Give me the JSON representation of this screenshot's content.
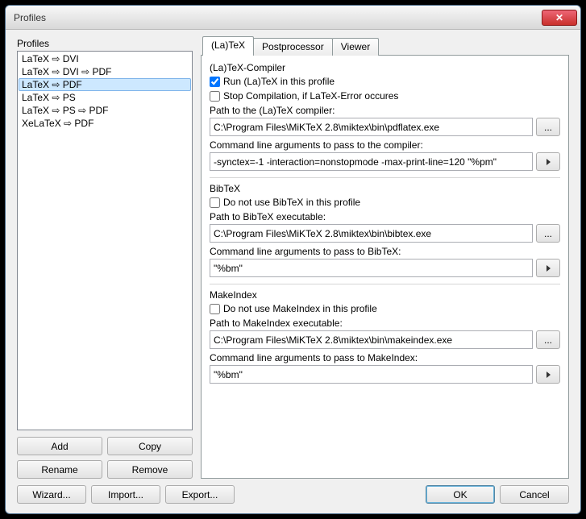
{
  "window": {
    "title": "Profiles"
  },
  "left": {
    "label": "Profiles",
    "items": [
      "LaTeX ⇨ DVI",
      "LaTeX ⇨ DVI ⇨ PDF",
      "LaTeX ⇨ PDF",
      "LaTeX ⇨ PS",
      "LaTeX ⇨ PS ⇨ PDF",
      "XeLaTeX ⇨ PDF"
    ],
    "selected_index": 2,
    "buttons": {
      "add": "Add",
      "copy": "Copy",
      "rename": "Rename",
      "remove": "Remove"
    }
  },
  "tabs": {
    "latex": "(La)TeX",
    "post": "Postprocessor",
    "viewer": "Viewer",
    "active": "latex"
  },
  "latex": {
    "group": "(La)TeX-Compiler",
    "run_label": "Run (La)TeX in this profile",
    "run_checked": true,
    "stop_label": "Stop Compilation, if LaTeX-Error occures",
    "stop_checked": false,
    "path_label": "Path to the (La)TeX compiler:",
    "path_value": "C:\\Program Files\\MiKTeX 2.8\\miktex\\bin\\pdflatex.exe",
    "args_label": "Command line arguments to pass to the compiler:",
    "args_value": "-synctex=-1 -interaction=nonstopmode -max-print-line=120 \"%pm\""
  },
  "bibtex": {
    "group": "BibTeX",
    "skip_label": "Do not use BibTeX in this profile",
    "skip_checked": false,
    "path_label": "Path to BibTeX executable:",
    "path_value": "C:\\Program Files\\MiKTeX 2.8\\miktex\\bin\\bibtex.exe",
    "args_label": "Command line arguments to pass to BibTeX:",
    "args_value": "\"%bm\""
  },
  "makeindex": {
    "group": "MakeIndex",
    "skip_label": "Do not use MakeIndex in this profile",
    "skip_checked": false,
    "path_label": "Path to MakeIndex executable:",
    "path_value": "C:\\Program Files\\MiKTeX 2.8\\miktex\\bin\\makeindex.exe",
    "args_label": "Command line arguments to pass to MakeIndex:",
    "args_value": "\"%bm\""
  },
  "bottom": {
    "wizard": "Wizard...",
    "import": "Import...",
    "export": "Export...",
    "ok": "OK",
    "cancel": "Cancel"
  },
  "browse_label": "..."
}
